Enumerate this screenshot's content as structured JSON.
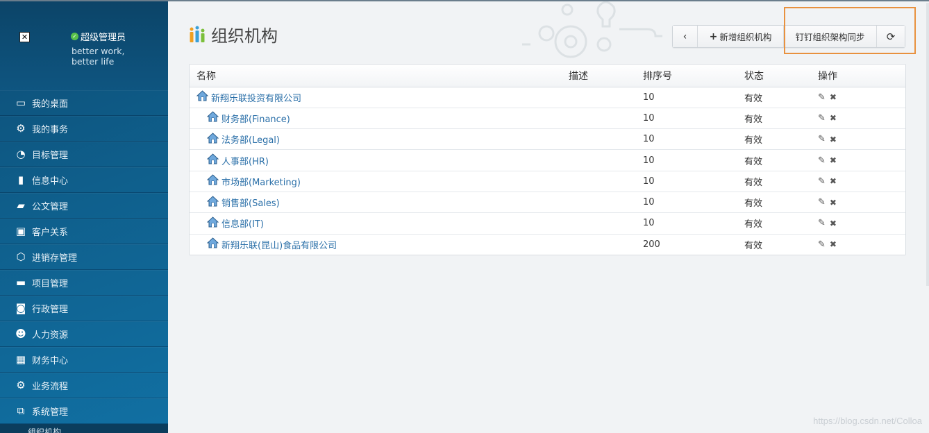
{
  "sidebar": {
    "user": {
      "name": "超级管理员",
      "motto": "better work, better life"
    },
    "items": [
      {
        "label": "我的桌面",
        "icon": "monitor-icon"
      },
      {
        "label": "我的事务",
        "icon": "gear-icon"
      },
      {
        "label": "目标管理",
        "icon": "dashboard-icon"
      },
      {
        "label": "信息中心",
        "icon": "book-icon"
      },
      {
        "label": "公文管理",
        "icon": "folder-star-icon"
      },
      {
        "label": "客户关系",
        "icon": "contact-card-icon"
      },
      {
        "label": "进销存管理",
        "icon": "handshake-icon"
      },
      {
        "label": "项目管理",
        "icon": "folder-icon"
      },
      {
        "label": "行政管理",
        "icon": "projector-icon"
      },
      {
        "label": "人力资源",
        "icon": "people-icon"
      },
      {
        "label": "财务中心",
        "icon": "calculator-icon"
      },
      {
        "label": "业务流程",
        "icon": "cog-icon"
      },
      {
        "label": "系统管理",
        "icon": "sitemap-icon"
      }
    ],
    "sub_item": "组织机构"
  },
  "page": {
    "title": "组织机构"
  },
  "toolbar": {
    "back_label": "‹",
    "add_label": "新增组织机构",
    "sync_label": "钉钉组织架构同步",
    "refresh_label": "⟳"
  },
  "table": {
    "headers": [
      "名称",
      "描述",
      "排序号",
      "状态",
      "操作"
    ],
    "rows": [
      {
        "name": "新翔乐联投资有限公司",
        "desc": "",
        "order": "10",
        "status": "有效",
        "level": 1
      },
      {
        "name": "财务部(Finance)",
        "desc": "",
        "order": "10",
        "status": "有效",
        "level": 2
      },
      {
        "name": "法务部(Legal)",
        "desc": "",
        "order": "10",
        "status": "有效",
        "level": 2
      },
      {
        "name": "人事部(HR)",
        "desc": "",
        "order": "10",
        "status": "有效",
        "level": 2
      },
      {
        "name": "市场部(Marketing)",
        "desc": "",
        "order": "10",
        "status": "有效",
        "level": 2
      },
      {
        "name": "销售部(Sales)",
        "desc": "",
        "order": "10",
        "status": "有效",
        "level": 2
      },
      {
        "name": "信息部(IT)",
        "desc": "",
        "order": "10",
        "status": "有效",
        "level": 2
      },
      {
        "name": "新翔乐联(昆山)食品有限公司",
        "desc": "",
        "order": "200",
        "status": "有效",
        "level": 2
      }
    ]
  },
  "watermark": "https://blog.csdn.net/Colloa",
  "colors": {
    "sidebar": "#0f5f8c",
    "link": "#2a6fa8",
    "highlight": "#e8913f"
  }
}
